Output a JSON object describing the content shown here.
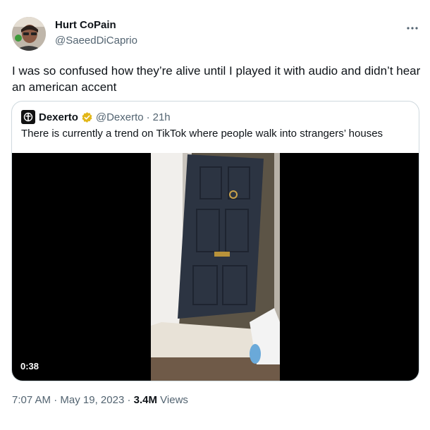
{
  "author": {
    "display_name": "Hurt CoPain",
    "handle": "@SaeedDiCaprio"
  },
  "menu_icon": "more-horizontal-icon",
  "tweet_text": "I was so confused how they’re alive until I played it with audio and didn’t hear an american accent",
  "quoted_tweet": {
    "display_name": "Dexerto",
    "verified": true,
    "badge_color": "#e2b719",
    "handle": "@Dexerto",
    "separator": "·",
    "time": "21h",
    "text": "There is currently a trend on TikTok where people walk into strangers’ houses",
    "video": {
      "duration": "0:38"
    }
  },
  "footer": {
    "time": "7:07 AM",
    "sep1": "·",
    "date": "May 19, 2023",
    "sep2": "·",
    "views_count": "3.4M",
    "views_label": "Views"
  }
}
